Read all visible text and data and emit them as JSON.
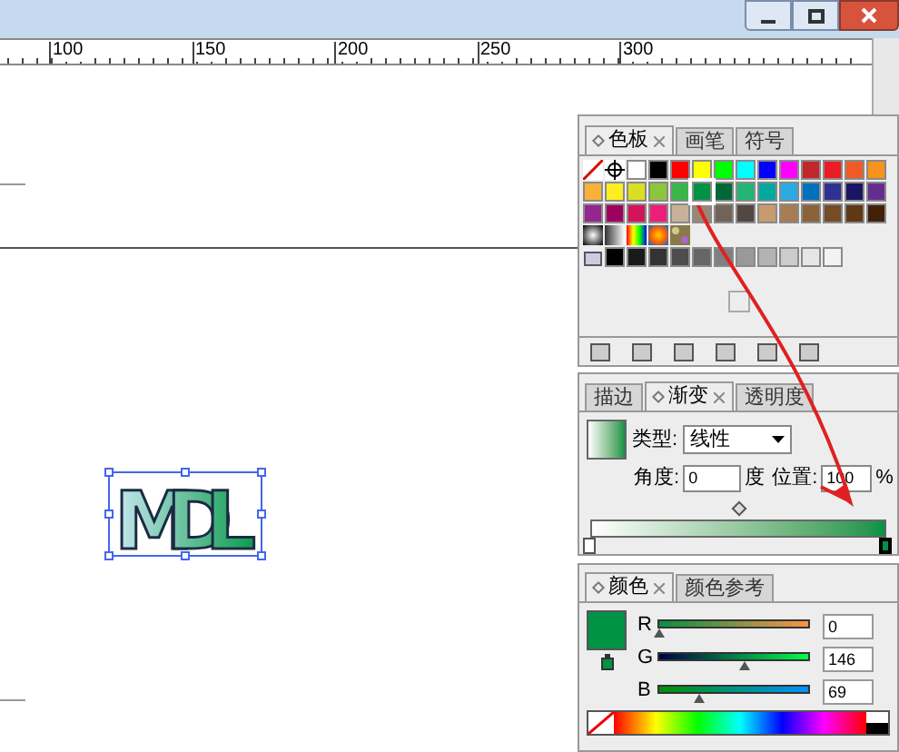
{
  "ruler": {
    "labels": [
      "100",
      "150",
      "200",
      "250",
      "300"
    ]
  },
  "artwork": {
    "text": "MDL",
    "selected": true
  },
  "swatches_panel": {
    "tabs": [
      {
        "label": "色板",
        "selected": true
      },
      {
        "label": "画笔",
        "selected": false
      },
      {
        "label": "符号",
        "selected": false
      }
    ],
    "rows": [
      [
        {
          "kind": "none",
          "selected": false
        },
        {
          "kind": "registration",
          "selected": false
        },
        {
          "kind": "solid",
          "color": "#ffffff",
          "selected": false
        },
        {
          "kind": "solid",
          "color": "#000000",
          "selected": false
        },
        {
          "kind": "solid",
          "color": "#ff0000",
          "selected": false
        },
        {
          "kind": "solid",
          "color": "#ffff00",
          "selected": false
        },
        {
          "kind": "solid",
          "color": "#00ff00",
          "selected": false
        },
        {
          "kind": "solid",
          "color": "#00ffff",
          "selected": false
        },
        {
          "kind": "solid",
          "color": "#0000ff",
          "selected": false
        },
        {
          "kind": "solid",
          "color": "#ff00ff",
          "selected": false
        },
        {
          "kind": "solid",
          "color": "#c1272d",
          "selected": false
        },
        {
          "kind": "solid",
          "color": "#ed1c24",
          "selected": false
        },
        {
          "kind": "solid",
          "color": "#f15a24",
          "selected": false
        },
        {
          "kind": "solid",
          "color": "#f7931e",
          "selected": false
        }
      ],
      [
        {
          "kind": "solid",
          "color": "#fbb03b",
          "selected": false
        },
        {
          "kind": "solid",
          "color": "#fcee21",
          "selected": false
        },
        {
          "kind": "solid",
          "color": "#d9e021",
          "selected": false
        },
        {
          "kind": "solid",
          "color": "#8cc63f",
          "selected": false
        },
        {
          "kind": "solid",
          "color": "#39b54a",
          "selected": false
        },
        {
          "kind": "solid",
          "color": "#009245",
          "selected": true
        },
        {
          "kind": "solid",
          "color": "#006837",
          "selected": false
        },
        {
          "kind": "solid",
          "color": "#22b573",
          "selected": false
        },
        {
          "kind": "solid",
          "color": "#00a99d",
          "selected": false
        },
        {
          "kind": "solid",
          "color": "#29abe2",
          "selected": false
        },
        {
          "kind": "solid",
          "color": "#0071bc",
          "selected": false
        },
        {
          "kind": "solid",
          "color": "#2e3192",
          "selected": false
        },
        {
          "kind": "solid",
          "color": "#1b1464",
          "selected": false
        },
        {
          "kind": "solid",
          "color": "#662d91",
          "selected": false
        }
      ],
      [
        {
          "kind": "solid",
          "color": "#93278f",
          "selected": false
        },
        {
          "kind": "solid",
          "color": "#9e005d",
          "selected": false
        },
        {
          "kind": "solid",
          "color": "#d4145a",
          "selected": false
        },
        {
          "kind": "solid",
          "color": "#ed1e79",
          "selected": false
        },
        {
          "kind": "solid",
          "color": "#c7b299",
          "selected": false
        },
        {
          "kind": "solid",
          "color": "#998675",
          "selected": false
        },
        {
          "kind": "solid",
          "color": "#736357",
          "selected": false
        },
        {
          "kind": "solid",
          "color": "#534741",
          "selected": false
        },
        {
          "kind": "solid",
          "color": "#c69c6d",
          "selected": false
        },
        {
          "kind": "solid",
          "color": "#a67c52",
          "selected": false
        },
        {
          "kind": "solid",
          "color": "#8c6239",
          "selected": false
        },
        {
          "kind": "solid",
          "color": "#754c24",
          "selected": false
        },
        {
          "kind": "solid",
          "color": "#603813",
          "selected": false
        },
        {
          "kind": "solid",
          "color": "#42210b",
          "selected": false
        }
      ],
      [
        {
          "kind": "gradient",
          "selected": false
        },
        {
          "kind": "gradient",
          "selected": false
        },
        {
          "kind": "gradient",
          "selected": false
        },
        {
          "kind": "gradient",
          "selected": false
        },
        {
          "kind": "pattern",
          "selected": false
        }
      ],
      [
        {
          "kind": "group",
          "selected": false
        },
        {
          "kind": "solid",
          "color": "#000000",
          "selected": false
        },
        {
          "kind": "solid",
          "color": "#1a1a1a",
          "selected": false
        },
        {
          "kind": "solid",
          "color": "#333333",
          "selected": false
        },
        {
          "kind": "solid",
          "color": "#4d4d4d",
          "selected": false
        },
        {
          "kind": "solid",
          "color": "#666666",
          "selected": false
        },
        {
          "kind": "solid",
          "color": "#808080",
          "selected": false
        },
        {
          "kind": "solid",
          "color": "#999999",
          "selected": false
        },
        {
          "kind": "solid",
          "color": "#b3b3b3",
          "selected": false
        },
        {
          "kind": "solid",
          "color": "#cccccc",
          "selected": false
        },
        {
          "kind": "solid",
          "color": "#e6e6e6",
          "selected": false
        },
        {
          "kind": "solid",
          "color": "#f2f2f2",
          "selected": false
        }
      ]
    ]
  },
  "gradient_panel": {
    "tabs": [
      {
        "label": "描边",
        "selected": false
      },
      {
        "label": "渐变",
        "selected": true
      },
      {
        "label": "透明度",
        "selected": false
      }
    ],
    "type_label": "类型:",
    "type_value": "线性",
    "angle_label": "角度:",
    "angle_value": "0",
    "angle_unit": "度",
    "location_label": "位置:",
    "location_value": "100",
    "location_unit": "%",
    "midpoint": {
      "level": 0.5
    },
    "stops": [
      {
        "color": "#ffffff",
        "selected": false,
        "level": 0
      },
      {
        "color": "#009245",
        "selected": true,
        "level": 1
      }
    ]
  },
  "color_panel": {
    "tabs": [
      {
        "label": "颜色",
        "selected": true
      },
      {
        "label": "颜色参考",
        "selected": false
      }
    ],
    "fill": {
      "color": "#009245"
    },
    "channels": [
      {
        "name": "R",
        "value": "0",
        "level": 0
      },
      {
        "name": "G",
        "value": "146",
        "level": 0.573
      },
      {
        "name": "B",
        "value": "69",
        "level": 0.271
      }
    ]
  }
}
